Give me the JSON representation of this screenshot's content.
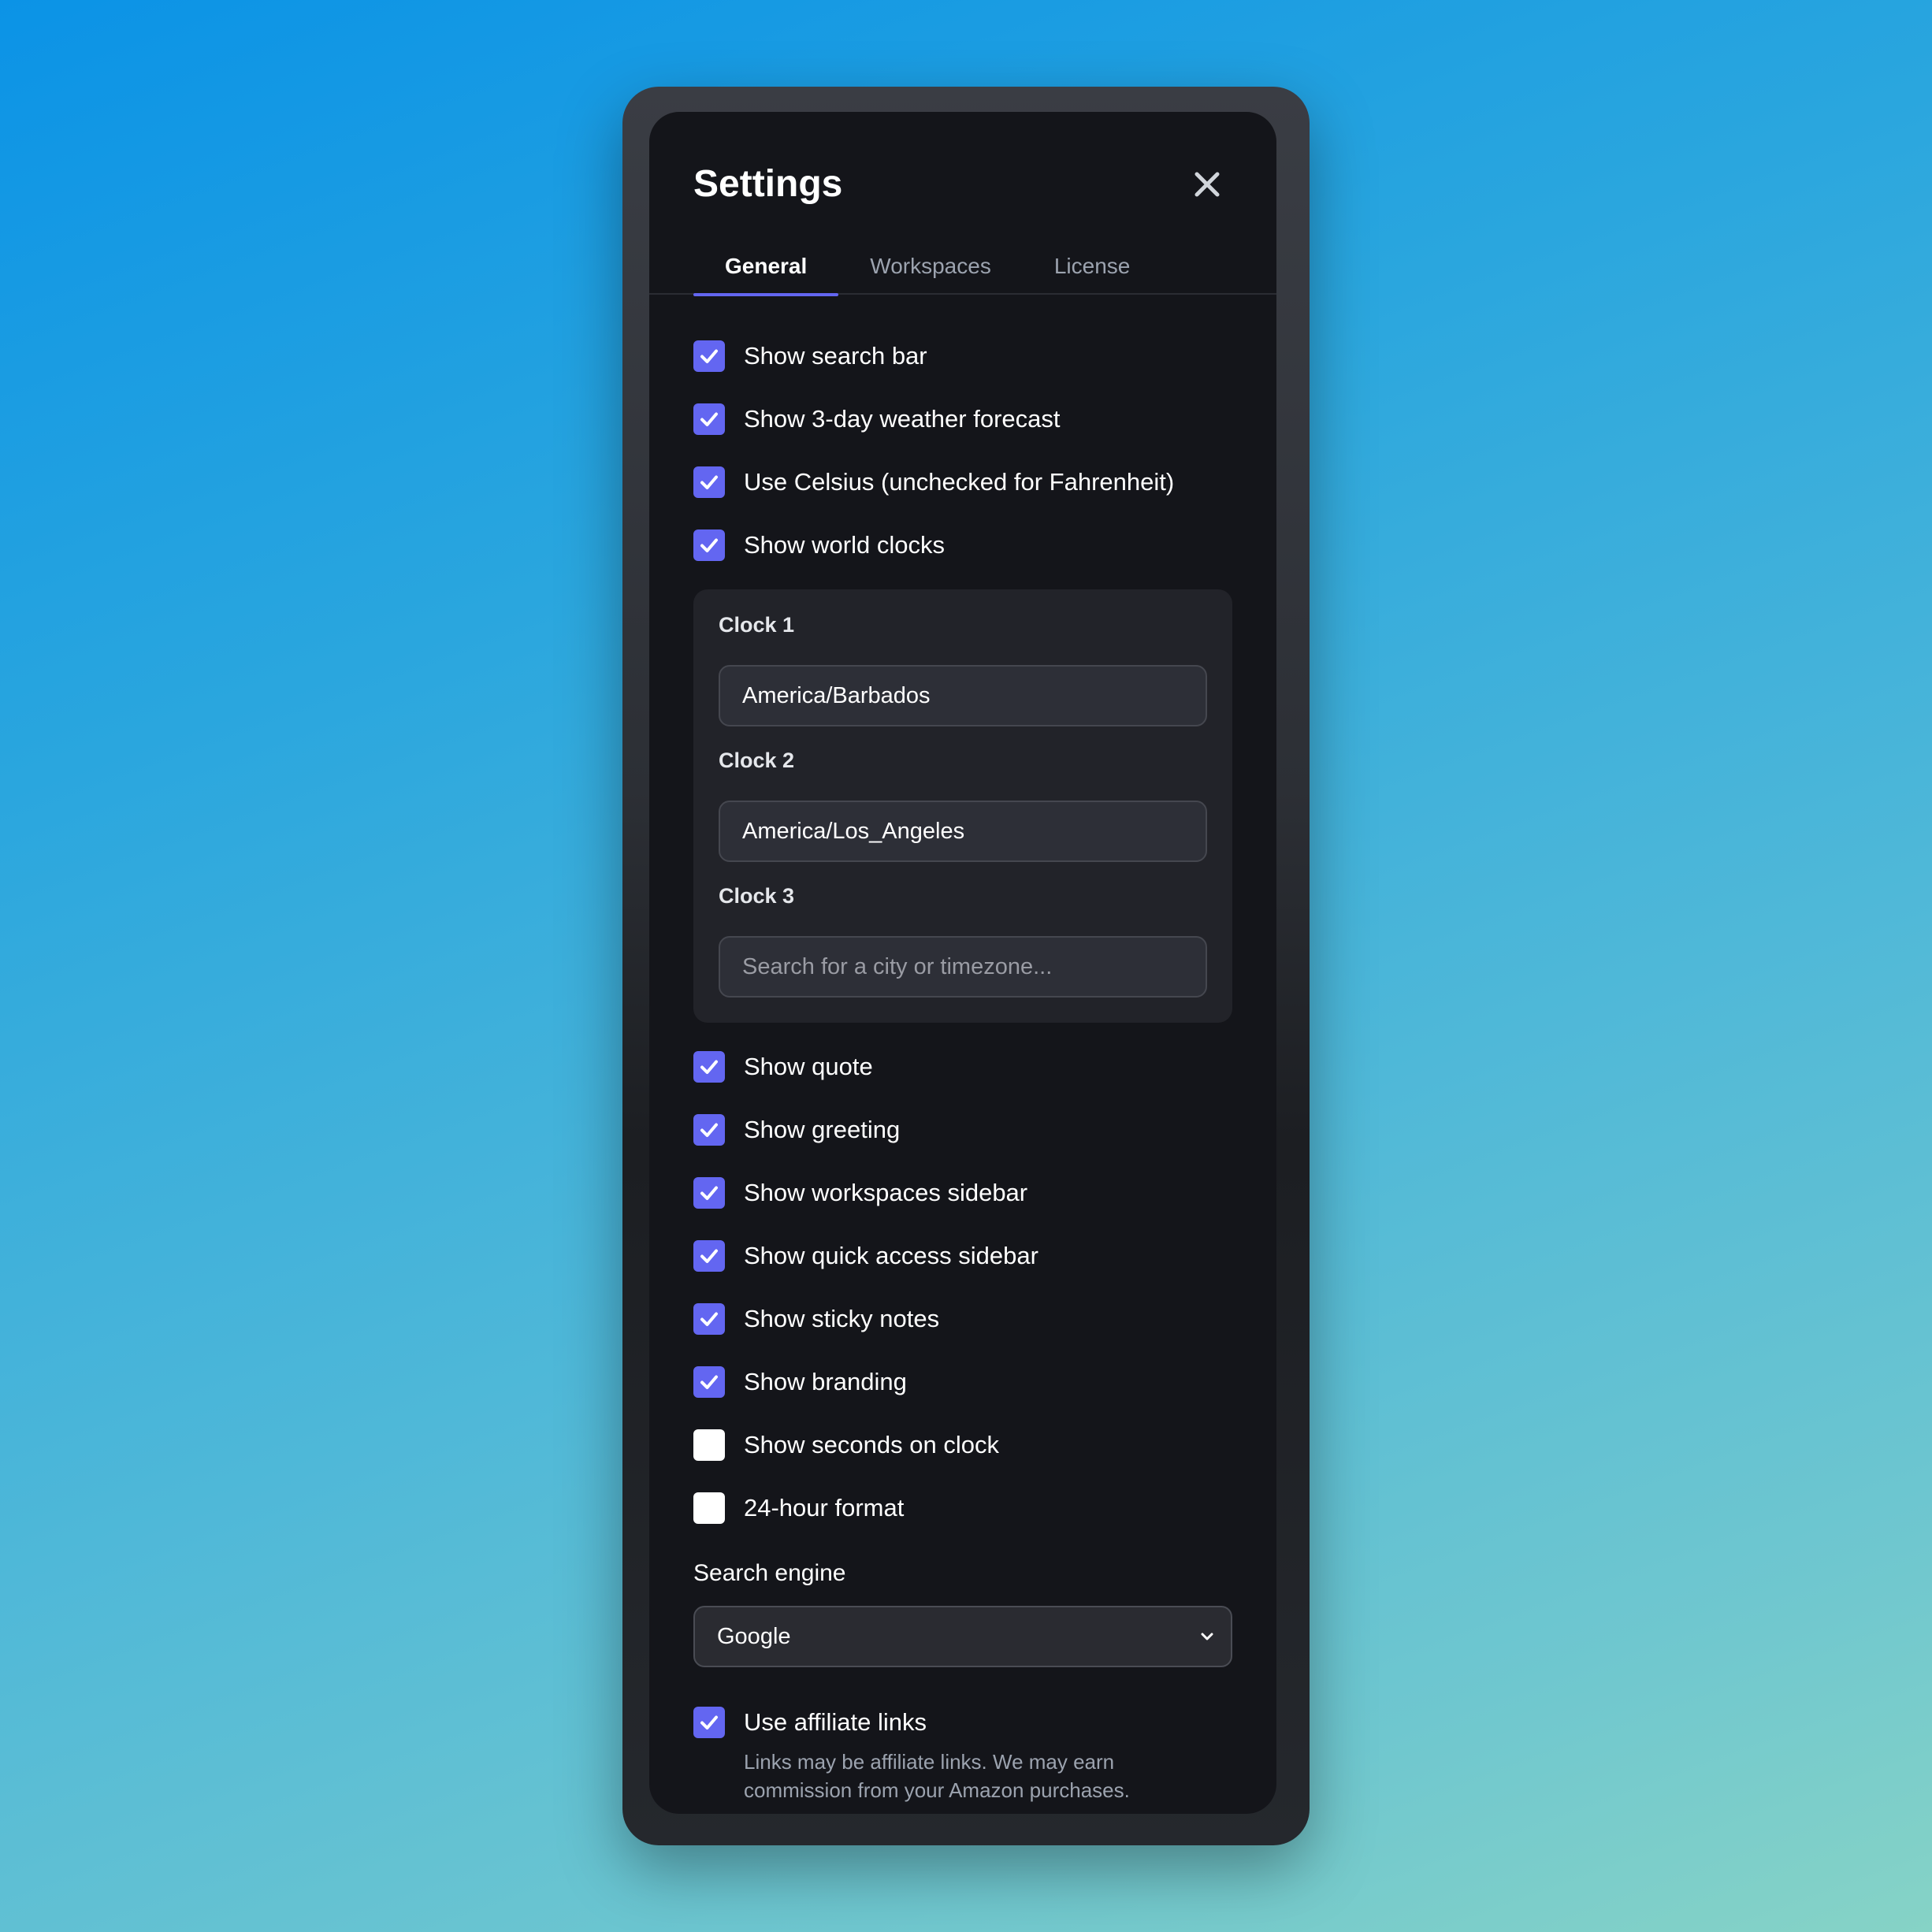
{
  "settings": {
    "title": "Settings",
    "tabs": [
      {
        "label": "General"
      },
      {
        "label": "Workspaces"
      },
      {
        "label": "License"
      }
    ],
    "checks_top": [
      {
        "label": "Show search bar",
        "checked": true
      },
      {
        "label": "Show 3-day weather forecast",
        "checked": true
      },
      {
        "label": "Use Celsius (unchecked for Fahrenheit)",
        "checked": true
      },
      {
        "label": "Show world clocks",
        "checked": true
      }
    ],
    "clocks": [
      {
        "label": "Clock 1",
        "value": "America/Barbados",
        "placeholder": ""
      },
      {
        "label": "Clock 2",
        "value": "America/Los_Angeles",
        "placeholder": ""
      },
      {
        "label": "Clock 3",
        "value": "",
        "placeholder": "Search for a city or timezone..."
      }
    ],
    "checks_bottom": [
      {
        "label": "Show quote",
        "checked": true
      },
      {
        "label": "Show greeting",
        "checked": true
      },
      {
        "label": "Show workspaces sidebar",
        "checked": true
      },
      {
        "label": "Show quick access sidebar",
        "checked": true
      },
      {
        "label": "Show sticky notes",
        "checked": true
      },
      {
        "label": "Show branding",
        "checked": true
      },
      {
        "label": "Show seconds on clock",
        "checked": false
      },
      {
        "label": "24-hour format",
        "checked": false
      }
    ],
    "search_engine": {
      "label": "Search engine",
      "selected": "Google"
    },
    "affiliate": {
      "label": "Use affiliate links",
      "checked": true,
      "note": "Links may be affiliate links. We may earn commission from your Amazon purchases."
    }
  },
  "colors": {
    "accent": "#6366f1",
    "panel_bg": "#14151a",
    "clock_box_bg": "#222329"
  }
}
